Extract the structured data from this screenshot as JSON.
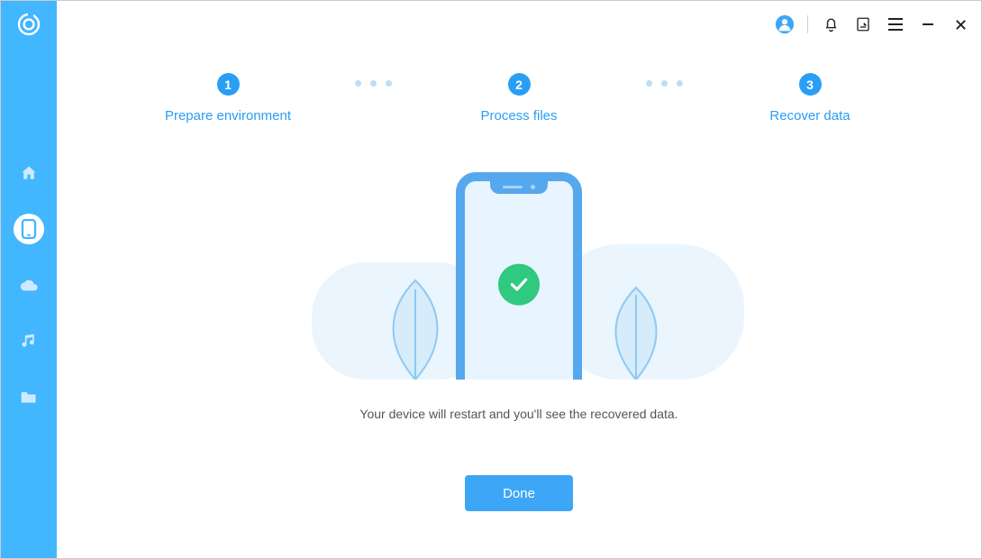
{
  "sidebar": {
    "logo_label": "logo",
    "items": [
      {
        "name": "home",
        "active": false
      },
      {
        "name": "device",
        "active": true
      },
      {
        "name": "cloud",
        "active": false
      },
      {
        "name": "music",
        "active": false
      },
      {
        "name": "folder",
        "active": false
      }
    ]
  },
  "titlebar": {
    "items": [
      {
        "name": "account"
      },
      {
        "name": "notifications"
      },
      {
        "name": "feedback"
      },
      {
        "name": "menu"
      },
      {
        "name": "minimize"
      },
      {
        "name": "close"
      }
    ]
  },
  "stepper": {
    "steps": [
      {
        "num": "1",
        "label": "Prepare environment"
      },
      {
        "num": "2",
        "label": "Process files"
      },
      {
        "num": "3",
        "label": "Recover data"
      }
    ]
  },
  "status": {
    "success": true,
    "message": "Your device will restart and you'll see the recovered data."
  },
  "actions": {
    "done_label": "Done"
  }
}
